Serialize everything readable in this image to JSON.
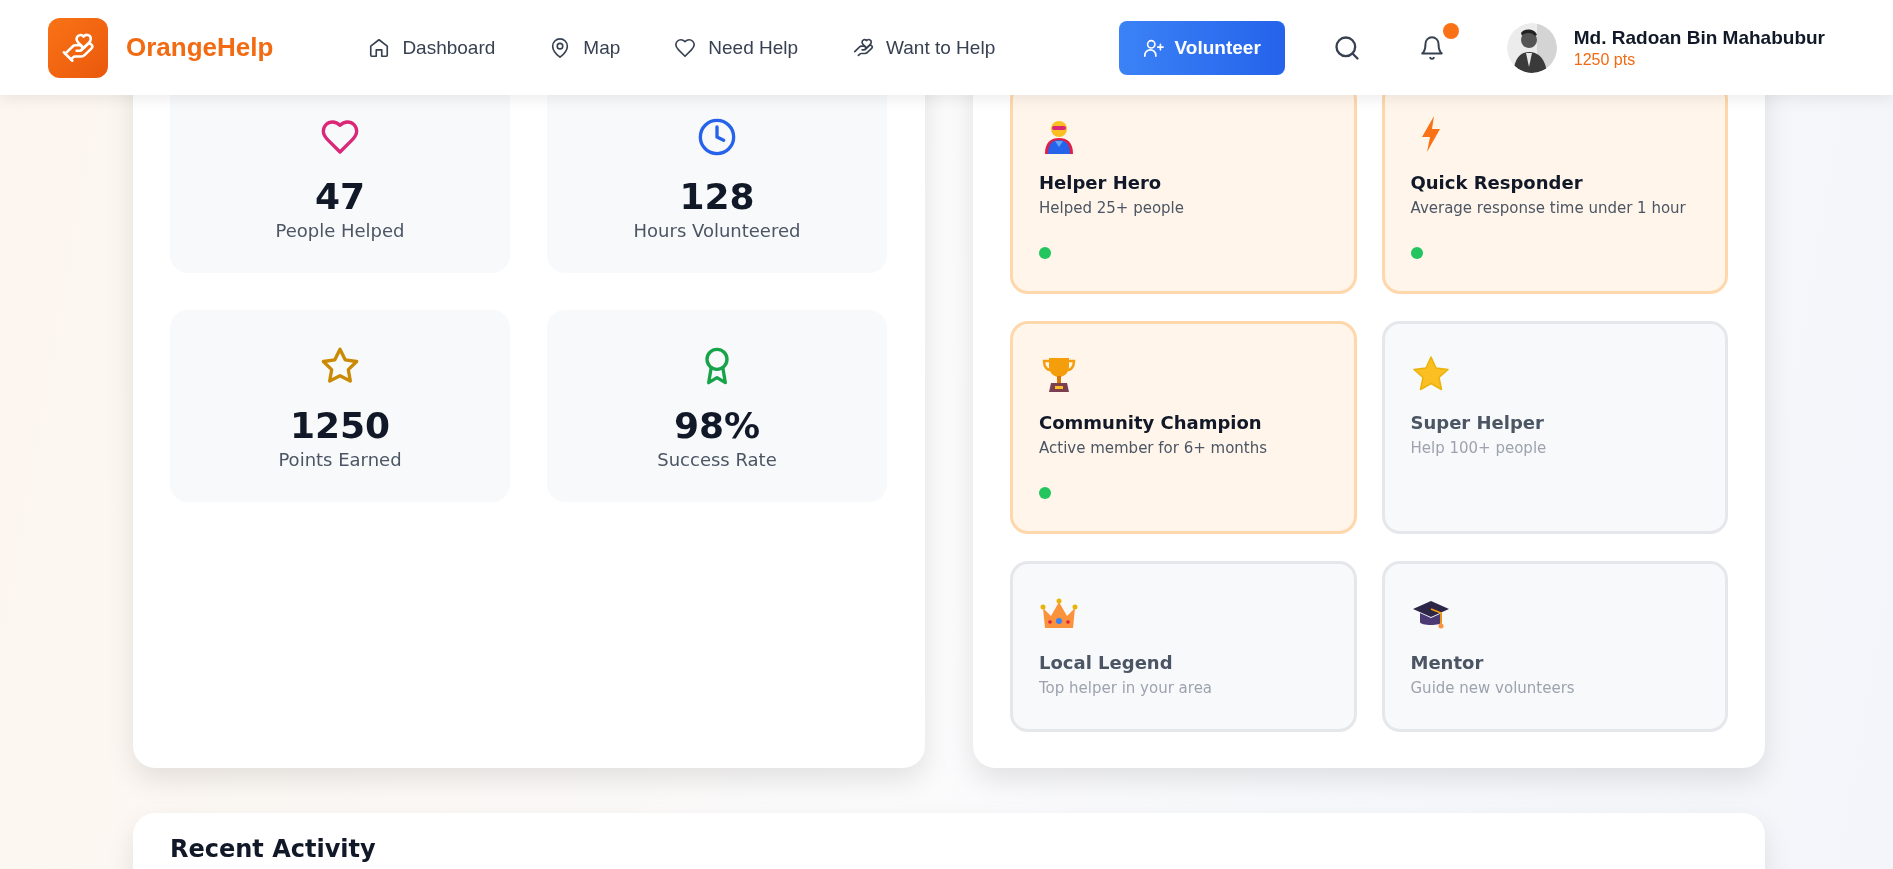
{
  "header": {
    "brand": "OrangeHelp",
    "nav": [
      {
        "label": "Dashboard",
        "kind": "home"
      },
      {
        "label": "Map",
        "kind": "pin"
      },
      {
        "label": "Need Help",
        "kind": "heart"
      },
      {
        "label": "Want to Help",
        "kind": "hand"
      }
    ],
    "volunteer_button": "Volunteer",
    "notification_dot": true,
    "user": {
      "name": "Md. Radoan Bin Mahabubur",
      "points": "1250 pts"
    }
  },
  "stats": [
    {
      "value": "47",
      "label": "People Helped",
      "kind": "heart",
      "color": "#db2777"
    },
    {
      "value": "128",
      "label": "Hours Volunteered",
      "kind": "clock",
      "color": "#2563eb"
    },
    {
      "value": "1250",
      "label": "Points Earned",
      "kind": "star",
      "color": "#ca8a04"
    },
    {
      "value": "98%",
      "label": "Success Rate",
      "kind": "award",
      "color": "#16a34a"
    }
  ],
  "achievements": [
    {
      "title": "Helper Hero",
      "description": "Helped 25+ people",
      "kind": "hero",
      "earned": true
    },
    {
      "title": "Quick Responder",
      "description": "Average response time under 1 hour",
      "kind": "bolt",
      "earned": true
    },
    {
      "title": "Community Champion",
      "description": "Active member for 6+ months",
      "kind": "trophy",
      "earned": true
    },
    {
      "title": "Super Helper",
      "description": "Help 100+ people",
      "kind": "star",
      "earned": false
    },
    {
      "title": "Local Legend",
      "description": "Top helper in your area",
      "kind": "crown",
      "earned": false
    },
    {
      "title": "Mentor",
      "description": "Guide new volunteers",
      "kind": "cap",
      "earned": false
    }
  ],
  "recent_activity": {
    "title": "Recent Activity"
  }
}
